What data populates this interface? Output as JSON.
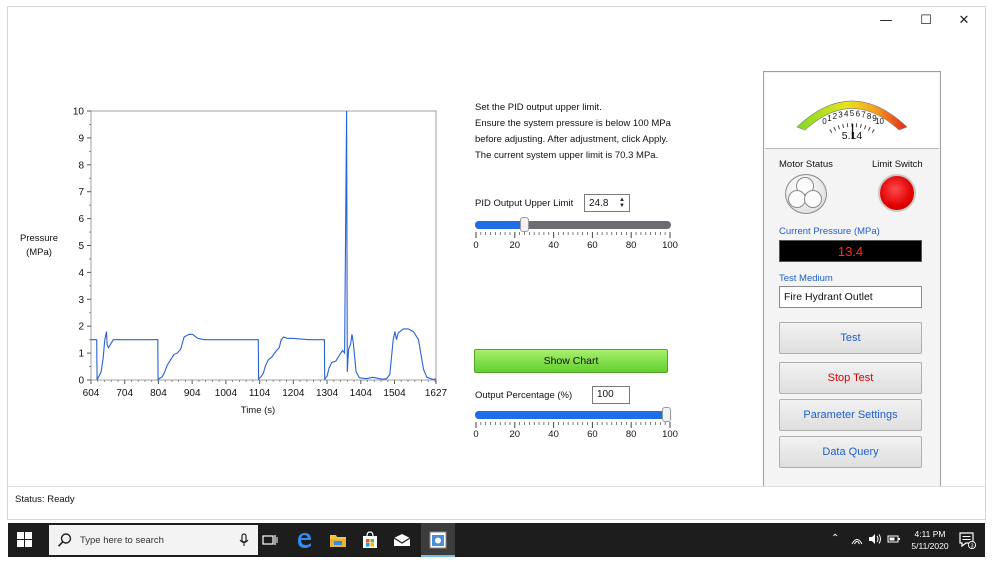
{
  "window": {
    "controls": {
      "minimize": "—",
      "maximize": "☐",
      "close": "✕"
    }
  },
  "chart_data": {
    "type": "line",
    "title": "",
    "xlabel": "Time (s)",
    "ylabel_line1": "Pressure",
    "ylabel_line2": "(MPa)",
    "xlim": [
      604,
      1627
    ],
    "ylim": [
      0,
      10
    ],
    "x_ticks": [
      604,
      704,
      804,
      904,
      1004,
      1104,
      1204,
      1304,
      1404,
      1504,
      1627
    ],
    "y_ticks": [
      0,
      1,
      2,
      3,
      4,
      5,
      6,
      7,
      8,
      9,
      10
    ],
    "series": [
      {
        "color": "#2a62d6",
        "x": [
          604,
          621,
          622,
          626,
          634,
          640,
          645,
          650,
          652,
          656,
          663,
          670,
          680,
          700,
          750,
          780,
          800,
          802,
          803,
          806,
          815,
          822,
          830,
          840,
          850,
          860,
          870,
          880,
          895,
          905,
          920,
          940,
          990,
          1010,
          1040,
          1080,
          1090,
          1100,
          1101,
          1102,
          1108,
          1115,
          1122,
          1130,
          1140,
          1148,
          1155,
          1162,
          1168,
          1175,
          1185,
          1200,
          1250,
          1296,
          1297,
          1298,
          1304,
          1310,
          1318,
          1330,
          1342,
          1350,
          1356,
          1362,
          1364,
          1366,
          1368,
          1374,
          1378,
          1382,
          1390,
          1400,
          1420,
          1440,
          1460,
          1470,
          1480,
          1490,
          1500,
          1505,
          1510,
          1515,
          1530,
          1545,
          1560,
          1575,
          1590,
          1600,
          1612,
          1620,
          1627
        ],
        "y": [
          1.5,
          1.5,
          0.0,
          0.1,
          0.3,
          0.8,
          1.5,
          1.8,
          1.3,
          1.2,
          1.35,
          1.5,
          1.5,
          1.5,
          1.5,
          1.5,
          1.5,
          1.5,
          0.0,
          0.05,
          0.12,
          0.28,
          0.55,
          0.75,
          0.95,
          1.0,
          1.15,
          1.6,
          1.7,
          1.7,
          1.55,
          1.5,
          1.5,
          1.5,
          1.5,
          1.5,
          1.5,
          1.5,
          0.0,
          0.05,
          0.12,
          0.25,
          0.55,
          0.75,
          0.85,
          1.0,
          1.1,
          1.2,
          1.5,
          1.6,
          1.55,
          1.55,
          1.5,
          1.5,
          0.0,
          0.05,
          0.15,
          0.45,
          0.65,
          0.7,
          0.95,
          1.1,
          1.0,
          10.0,
          0.3,
          0.8,
          1.15,
          1.35,
          1.7,
          1.35,
          0.3,
          0.08,
          0.05,
          0.1,
          0.05,
          0.03,
          0.05,
          0.2,
          1.5,
          1.8,
          1.5,
          1.75,
          1.9,
          1.9,
          1.8,
          1.5,
          0.4,
          0.1,
          0.05,
          0.02,
          0.05
        ]
      }
    ]
  },
  "pid": {
    "instructions": [
      "Set the PID output upper limit.",
      "Ensure the system pressure is below 100 MPa",
      "before adjusting. After adjustment, click Apply.",
      "The current system upper limit is 70.3 MPa."
    ],
    "upper_limit_label": "PID Output Upper Limit",
    "upper_limit_value": "24.8",
    "upper_limit_slider_value": 24.8,
    "slider_ticks": [
      "0",
      "20",
      "40",
      "60",
      "80",
      "100"
    ],
    "show_chart_label": "Show Chart",
    "output_percentage_label": "Output Percentage (%)",
    "output_percentage_value": "100",
    "output_percentage_slider_value": 100
  },
  "panel": {
    "gauge": {
      "value": 5.14,
      "value_text": "5.14",
      "min": 0,
      "max": 10,
      "labels": [
        "0",
        "1",
        "2",
        "3",
        "4",
        "5",
        "6",
        "7",
        "8",
        "9",
        "10"
      ]
    },
    "motor_status_label": "Motor Status",
    "limit_switch_label": "Limit Switch",
    "limit_switch_color": "#e00000",
    "current_pressure_label": "Current Pressure (MPa)",
    "current_pressure_value": "13.4",
    "test_medium_label": "Test Medium",
    "test_medium_value": "Fire Hydrant Outlet",
    "buttons": {
      "test": "Test",
      "stop_test": "Stop Test",
      "parameter_settings": "Parameter Settings",
      "data_query": "Data Query"
    }
  },
  "status": {
    "text": "Status:  Ready"
  },
  "taskbar": {
    "search_placeholder": "Type here to search",
    "time": "4:11 PM",
    "date": "5/11/2020",
    "notification_count": "3"
  }
}
